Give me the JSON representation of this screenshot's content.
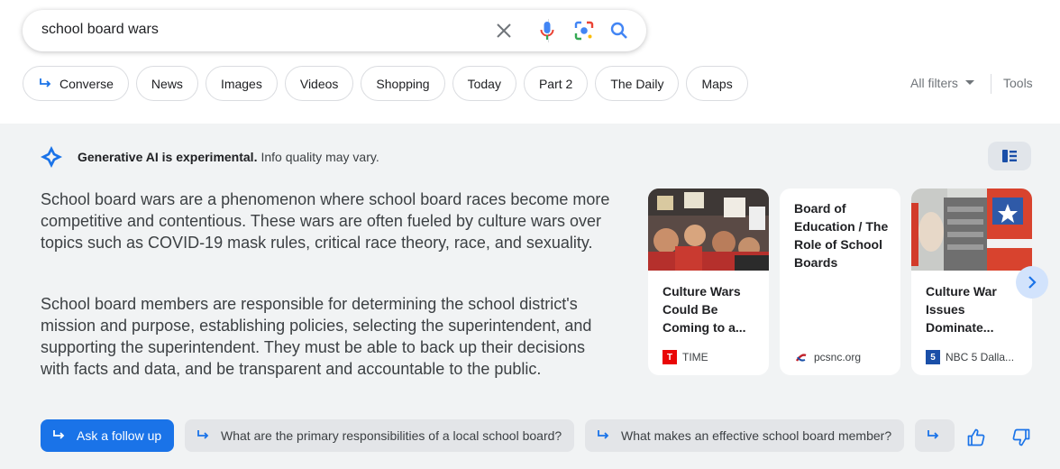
{
  "search": {
    "query": "school board wars"
  },
  "chips": [
    "Converse",
    "News",
    "Images",
    "Videos",
    "Shopping",
    "Today",
    "Part 2",
    "The Daily",
    "Maps"
  ],
  "tools": {
    "all_filters": "All filters",
    "tools": "Tools"
  },
  "ai_overview": {
    "notice_bold": "Generative AI is experimental.",
    "notice_rest": "Info quality may vary.",
    "paragraph1": "School board wars are a phenomenon where school board races become more competitive and contentious. These wars are often fueled by culture wars over topics such as COVID-19 mask rules, critical race theory, race, and sexuality.",
    "paragraph2": "School board members are responsible for determining the school district's mission and purpose, establishing policies, selecting the superintendent, and supporting the superintendent. They must be able to back up their decisions with facts and data, and be transparent and accountable to the public."
  },
  "cards": [
    {
      "title": "Culture Wars Could Be Coming to a...",
      "source": "TIME"
    },
    {
      "title": "Board of Education / The Role of School Boards",
      "source": "pcsnc.org"
    },
    {
      "title": "Culture War Issues Dominate...",
      "source": "NBC 5 Dalla..."
    }
  ],
  "followups": {
    "ask": "Ask a follow up",
    "suggestions": [
      "What are the primary responsibilities of a local school board?",
      "What makes an effective school board member?"
    ]
  },
  "colors": {
    "accent": "#1a73e8",
    "panel": "#f1f3f4",
    "time_red": "#e90606"
  }
}
